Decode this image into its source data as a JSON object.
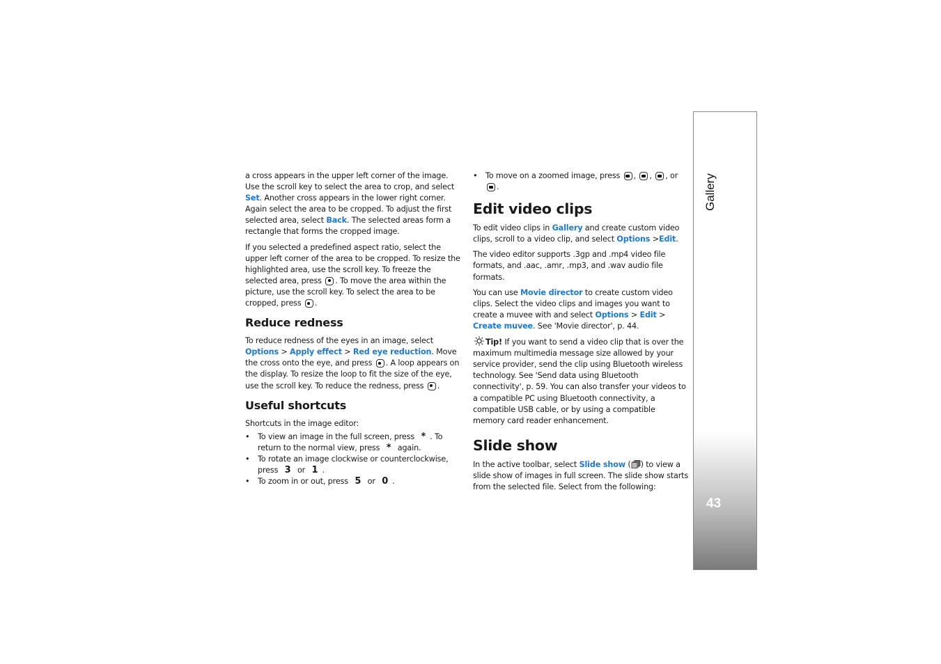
{
  "sidebar": {
    "section_label": "Gallery",
    "page_number": "43"
  },
  "col1": {
    "p1": {
      "t1": "a cross appears in the upper left corner of the image. Use the scroll key to select the area to crop, and select ",
      "l1": "Set",
      "t2": ". Another cross appears in the lower right corner. Again select the area to be cropped. To adjust the first selected area, select ",
      "l2": "Back",
      "t3": ". The selected areas form a rectangle that forms the cropped image."
    },
    "p2": {
      "t1": "If you selected a predefined aspect ratio, select the upper left corner of the area to be cropped. To resize the highlighted area, use the scroll key. To freeze the selected area, press ",
      "t2": ". To move the area within the picture, use the scroll key. To select the area to be cropped, press ",
      "t3": "."
    },
    "reduce_redness": {
      "heading": "Reduce redness",
      "t1": "To reduce redness of the eyes in an image, select ",
      "l1": "Options",
      "s1": " > ",
      "l2": "Apply effect",
      "s2": " > ",
      "l3": "Red eye reduction",
      "t2": ". Move the cross onto the eye, and press ",
      "t3": ". A loop appears on the display. To resize the loop to fit the size of the eye, use the scroll key. To reduce the redness, press ",
      "t4": "."
    },
    "shortcuts": {
      "heading": "Useful shortcuts",
      "intro": "Shortcuts in the image editor:",
      "bullet": "•",
      "items": [
        {
          "t1": "To view an image in the full screen, press ",
          "k1": "*",
          "t2": ". To return to the normal view, press ",
          "k2": "*",
          "t3": " again."
        },
        {
          "t1": "To rotate an image clockwise or counterclockwise, press ",
          "k1": "3",
          "t2": " or ",
          "k2": "1",
          "t3": "."
        },
        {
          "t1": "To zoom in or out, press ",
          "k1": "5",
          "t2": " or ",
          "k2": "0",
          "t3": "."
        }
      ]
    }
  },
  "col2": {
    "move_item": {
      "bullet": "•",
      "t1": "To move on a zoomed image, press ",
      "s1": ", ",
      "s2": ", ",
      "s3": ", or ",
      "t2": "."
    },
    "edit_video": {
      "heading": "Edit video clips",
      "p1": {
        "t1": "To edit video clips in ",
        "l1": "Gallery",
        "t2": " and create custom video clips, scroll to a video clip, and select ",
        "l2": "Options",
        "s1": " >",
        "l3": "Edit",
        "t3": "."
      },
      "p2": "The video editor supports .3gp and .mp4 video file formats, and .aac, .amr, .mp3, and .wav audio file formats.",
      "p3": {
        "t1": "You can use ",
        "l1": "Movie director",
        "t2": " to create custom video clips. Select the video clips and images you want to create a muvee with and select ",
        "l2": "Options",
        "s1": " > ",
        "l3": "Edit",
        "s2": " > ",
        "l4": "Create muvee",
        "t3": ". See 'Movie director', p. 44."
      },
      "tip": {
        "label": "Tip!",
        "text": " If you want to send a video clip that is over the maximum multimedia message size allowed by your service provider, send the clip using Bluetooth wireless technology. See 'Send data using Bluetooth connectivity', p. 59. You can also transfer your videos to a compatible PC using Bluetooth connectivity, a compatible USB cable, or by using a compatible memory card reader enhancement."
      }
    },
    "slide_show": {
      "heading": "Slide show",
      "t1": "In the active toolbar, select ",
      "l1": "Slide show",
      "s1": " (",
      "s2": ") to view a slide show of images in full screen. The slide show starts from the selected file. Select from the following:"
    }
  },
  "colors": {
    "link": "#1a7ae0",
    "text": "#1a1a1a",
    "sidebar_border": "#8a8a8a"
  }
}
